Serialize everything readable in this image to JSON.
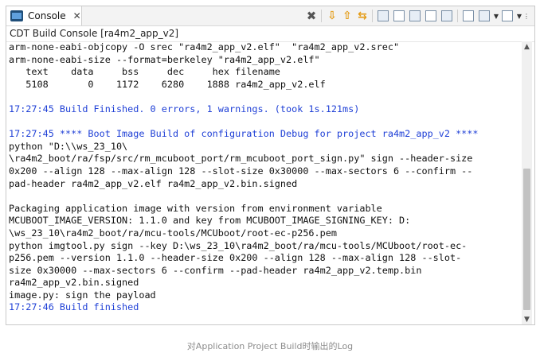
{
  "tab": {
    "label": "Console",
    "close_glyph": "✕",
    "icon": "console-icon"
  },
  "toolbar": {
    "icons": [
      "remove-all-terminated-icon",
      "scroll-down-icon",
      "scroll-up-icon",
      "pin-icon",
      "clear-console-icon",
      "scroll-lock-icon",
      "word-wrap-icon",
      "show-console-icon",
      "open-console-icon",
      "display-console-icon",
      "view-menu-icon"
    ]
  },
  "console_name": "CDT Build Console [ra4m2_app_v2]",
  "lines": [
    {
      "text": "arm-none-eabi-objcopy -O srec \"ra4m2_app_v2.elf\"  \"ra4m2_app_v2.srec\"",
      "color": "normal"
    },
    {
      "text": "arm-none-eabi-size --format=berkeley \"ra4m2_app_v2.elf\"",
      "color": "normal"
    },
    {
      "text": "   text    data     bss     dec     hex filename",
      "color": "normal"
    },
    {
      "text": "   5108       0    1172    6280    1888 ra4m2_app_v2.elf",
      "color": "normal"
    },
    {
      "text": "",
      "color": "normal"
    },
    {
      "text": "17:27:45 Build Finished. 0 errors, 1 warnings. (took 1s.121ms)",
      "color": "blue"
    },
    {
      "text": "",
      "color": "normal"
    },
    {
      "text": "17:27:45 **** Boot Image Build of configuration Debug for project ra4m2_app_v2 ****",
      "color": "blue"
    },
    {
      "text": "python \"D:\\\\ws_23_10\\",
      "color": "normal"
    },
    {
      "text": "\\ra4m2_boot/ra/fsp/src/rm_mcuboot_port/rm_mcuboot_port_sign.py\" sign --header-size",
      "color": "normal"
    },
    {
      "text": "0x200 --align 128 --max-align 128 --slot-size 0x30000 --max-sectors 6 --confirm --",
      "color": "normal"
    },
    {
      "text": "pad-header ra4m2_app_v2.elf ra4m2_app_v2.bin.signed",
      "color": "normal"
    },
    {
      "text": "",
      "color": "normal"
    },
    {
      "text": "Packaging application image with version from environment variable",
      "color": "normal"
    },
    {
      "text": "MCUBOOT_IMAGE_VERSION: 1.1.0 and key from MCUBOOT_IMAGE_SIGNING_KEY: D:",
      "color": "normal"
    },
    {
      "text": "\\ws_23_10\\ra4m2_boot/ra/mcu-tools/MCUboot/root-ec-p256.pem",
      "color": "normal"
    },
    {
      "text": "python imgtool.py sign --key D:\\ws_23_10\\ra4m2_boot/ra/mcu-tools/MCUboot/root-ec-",
      "color": "normal"
    },
    {
      "text": "p256.pem --version 1.1.0 --header-size 0x200 --align 128 --max-align 128 --slot-",
      "color": "normal"
    },
    {
      "text": "size 0x30000 --max-sectors 6 --confirm --pad-header ra4m2_app_v2.temp.bin",
      "color": "normal"
    },
    {
      "text": "ra4m2_app_v2.bin.signed",
      "color": "normal"
    },
    {
      "text": "image.py: sign the payload",
      "color": "normal"
    },
    {
      "text": "17:27:46 Build finished",
      "color": "blue"
    }
  ],
  "caption": "对Application Project Build时输出的Log",
  "colors": {
    "blue": "#1e3fd6",
    "normal": "#111111"
  }
}
